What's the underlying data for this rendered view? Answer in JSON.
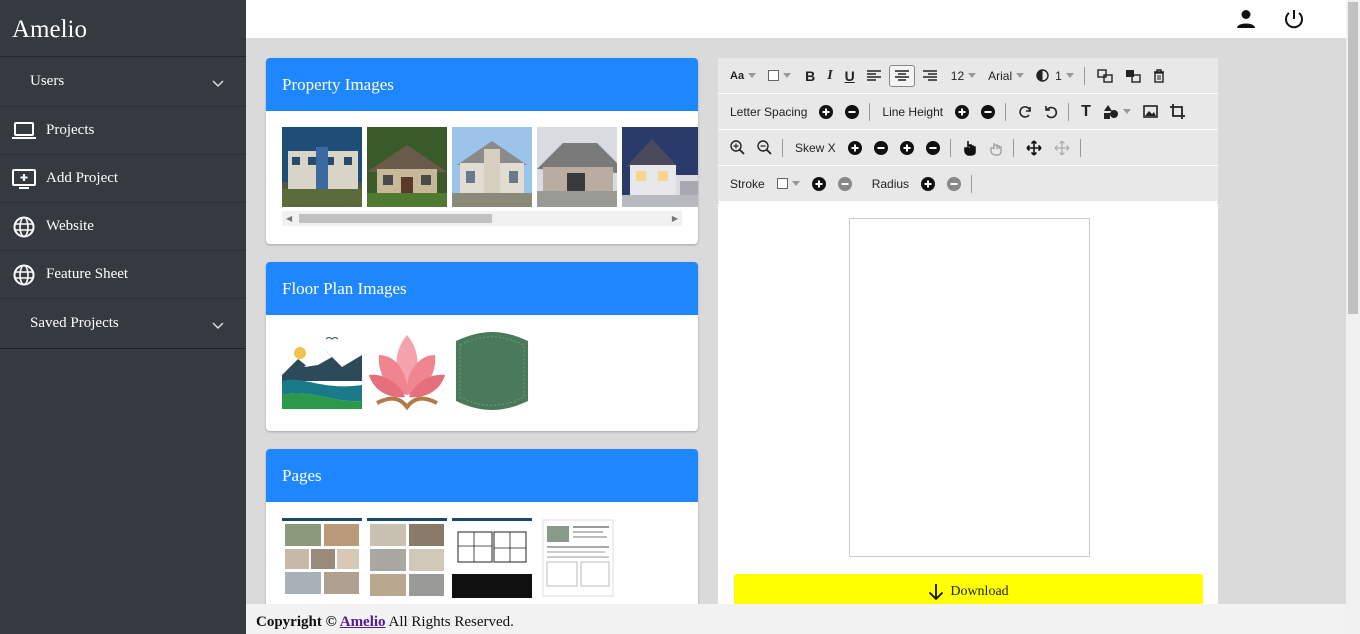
{
  "sidebar": {
    "brand": "Amelio",
    "items": [
      {
        "label": "Users",
        "icon": "chevron-down-icon"
      },
      {
        "label": "Projects",
        "icon": "laptop-icon"
      },
      {
        "label": "Add Project",
        "icon": "add-screen-icon"
      },
      {
        "label": "Website",
        "icon": "globe-icon"
      },
      {
        "label": "Feature Sheet",
        "icon": "globe-icon"
      },
      {
        "label": "Saved Projects",
        "icon": "chevron-down-icon"
      }
    ]
  },
  "topbar": {
    "icons": [
      "user-icon",
      "power-icon"
    ]
  },
  "cards": {
    "property": {
      "title": "Property Images"
    },
    "floor": {
      "title": "Floor Plan Images"
    },
    "pages": {
      "title": "Pages"
    }
  },
  "toolbar": {
    "font_size_button": "Aa",
    "font_size": "12",
    "font_family": "Arial",
    "opacity": "1",
    "letter_spacing": "Letter Spacing",
    "line_height": "Line Height",
    "skew_x": "Skew X",
    "stroke": "Stroke",
    "radius": "Radius"
  },
  "download_label": "Download",
  "footer": {
    "prefix": "Copyright ©",
    "link": "Amelio",
    "suffix": "All Rights Reserved."
  },
  "colors": {
    "sidebar_bg": "#343a40",
    "card_header": "#1e87ff",
    "download_bg": "#ffff00"
  }
}
